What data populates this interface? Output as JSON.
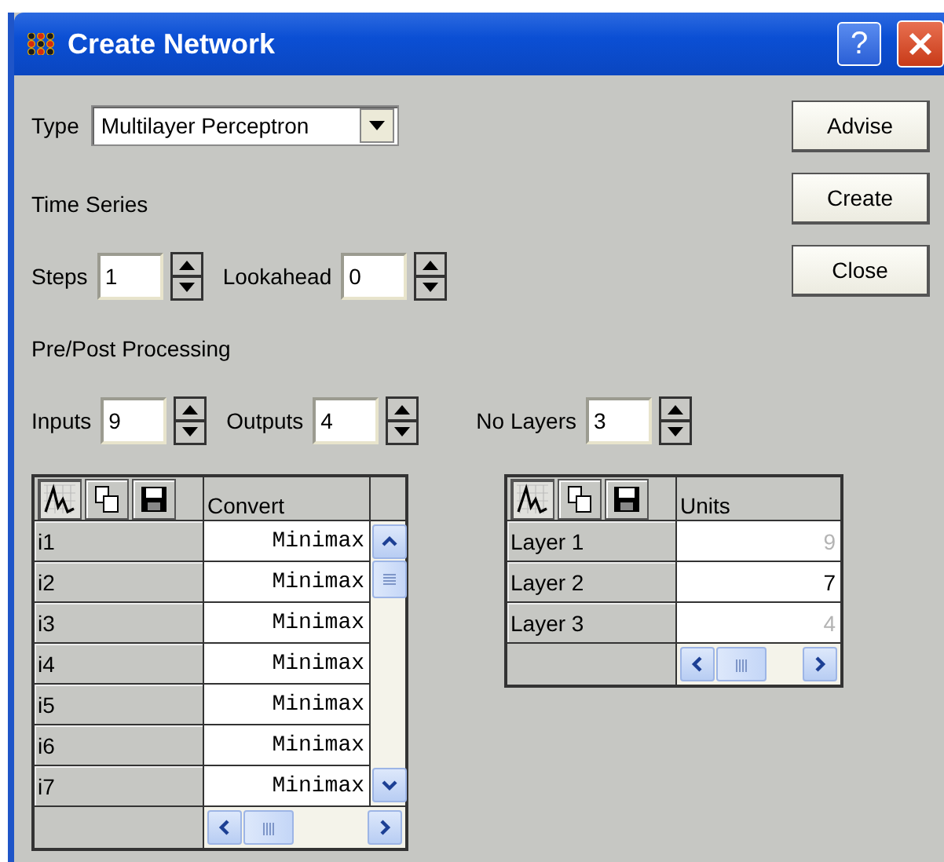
{
  "window": {
    "title": "Create Network",
    "help_button": "?"
  },
  "type_field": {
    "label": "Type",
    "value": "Multilayer Perceptron"
  },
  "time_series": {
    "heading": "Time Series",
    "steps": {
      "label": "Steps",
      "value": "1"
    },
    "lookahead": {
      "label": "Lookahead",
      "value": "0"
    }
  },
  "processing": {
    "heading": "Pre/Post Processing",
    "inputs": {
      "label": "Inputs",
      "value": "9"
    },
    "outputs": {
      "label": "Outputs",
      "value": "4"
    },
    "no_layers": {
      "label": "No Layers",
      "value": "3"
    }
  },
  "buttons": [
    "Advise",
    "Create",
    "Close"
  ],
  "inputs_table": {
    "column": "Convert",
    "rows": [
      {
        "name": "i1",
        "value": "Minimax"
      },
      {
        "name": "i2",
        "value": "Minimax"
      },
      {
        "name": "i3",
        "value": "Minimax"
      },
      {
        "name": "i4",
        "value": "Minimax"
      },
      {
        "name": "i5",
        "value": "Minimax"
      },
      {
        "name": "i6",
        "value": "Minimax"
      },
      {
        "name": "i7",
        "value": "Minimax"
      }
    ]
  },
  "layers_table": {
    "column": "Units",
    "rows": [
      {
        "name": "Layer 1",
        "value": "9",
        "disabled": true
      },
      {
        "name": "Layer 2",
        "value": "7",
        "disabled": false
      },
      {
        "name": "Layer 3",
        "value": "4",
        "disabled": true
      }
    ]
  }
}
